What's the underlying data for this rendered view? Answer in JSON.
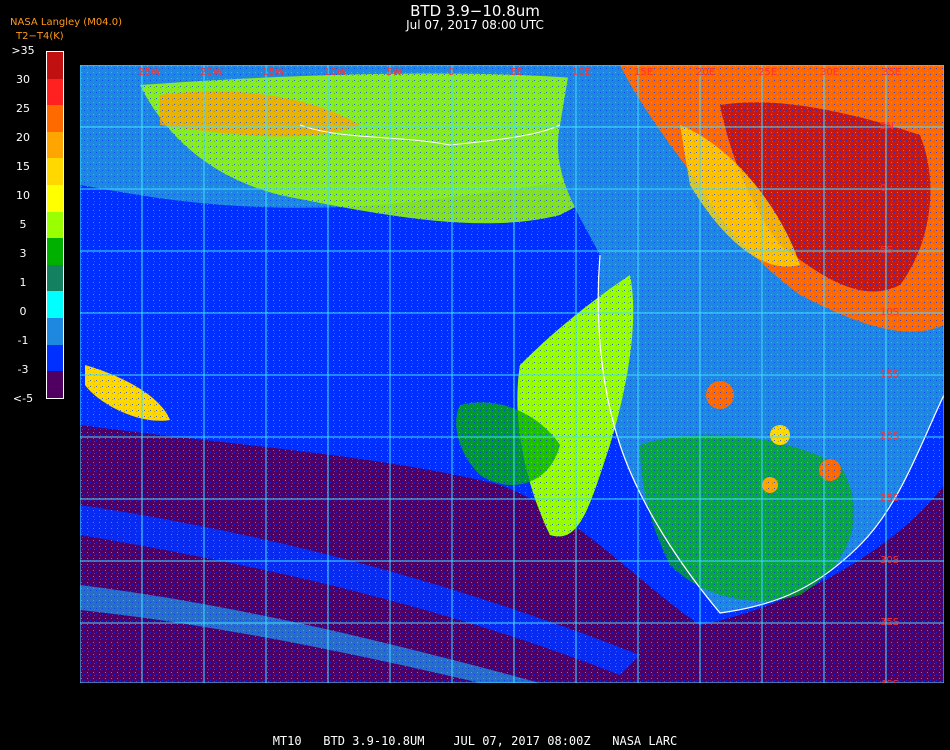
{
  "header": {
    "title": "BTD 3.9−10.8um",
    "datetime": "Jul 07, 2017 08:00 UTC",
    "source": "NASA Langley (M04.0)",
    "units": "T2−T4(K)"
  },
  "legend": {
    "labels": [
      ">35",
      "30",
      "25",
      "20",
      "15",
      "10",
      "5",
      "3",
      "1",
      "0",
      "-1",
      "-3",
      "<-5"
    ],
    "colors": [
      "#c01010",
      "#ff2020",
      "#ff6a00",
      "#ffa500",
      "#ffd800",
      "#ffff00",
      "#9aff00",
      "#00b000",
      "#138060",
      "#00ffff",
      "#1e88e0",
      "#0030ff",
      "#500060"
    ]
  },
  "map": {
    "longitude_labels": [
      "25W",
      "20W",
      "15W",
      "10W",
      "5W",
      "0",
      "5E",
      "10E",
      "15E",
      "20E",
      "25E",
      "30E",
      "35E"
    ],
    "latitude_labels": [
      "5N",
      "0",
      "5S",
      "10S",
      "15S",
      "20S",
      "25S",
      "30S",
      "35S",
      "40S"
    ]
  },
  "footer": {
    "text": "MT10   BTD 3.9-10.8UM    JUL 07, 2017 08:00Z   NASA LARC"
  },
  "colors": {
    "grid": "#40e0ff",
    "coast": "#ffffff",
    "background": "#000000"
  }
}
